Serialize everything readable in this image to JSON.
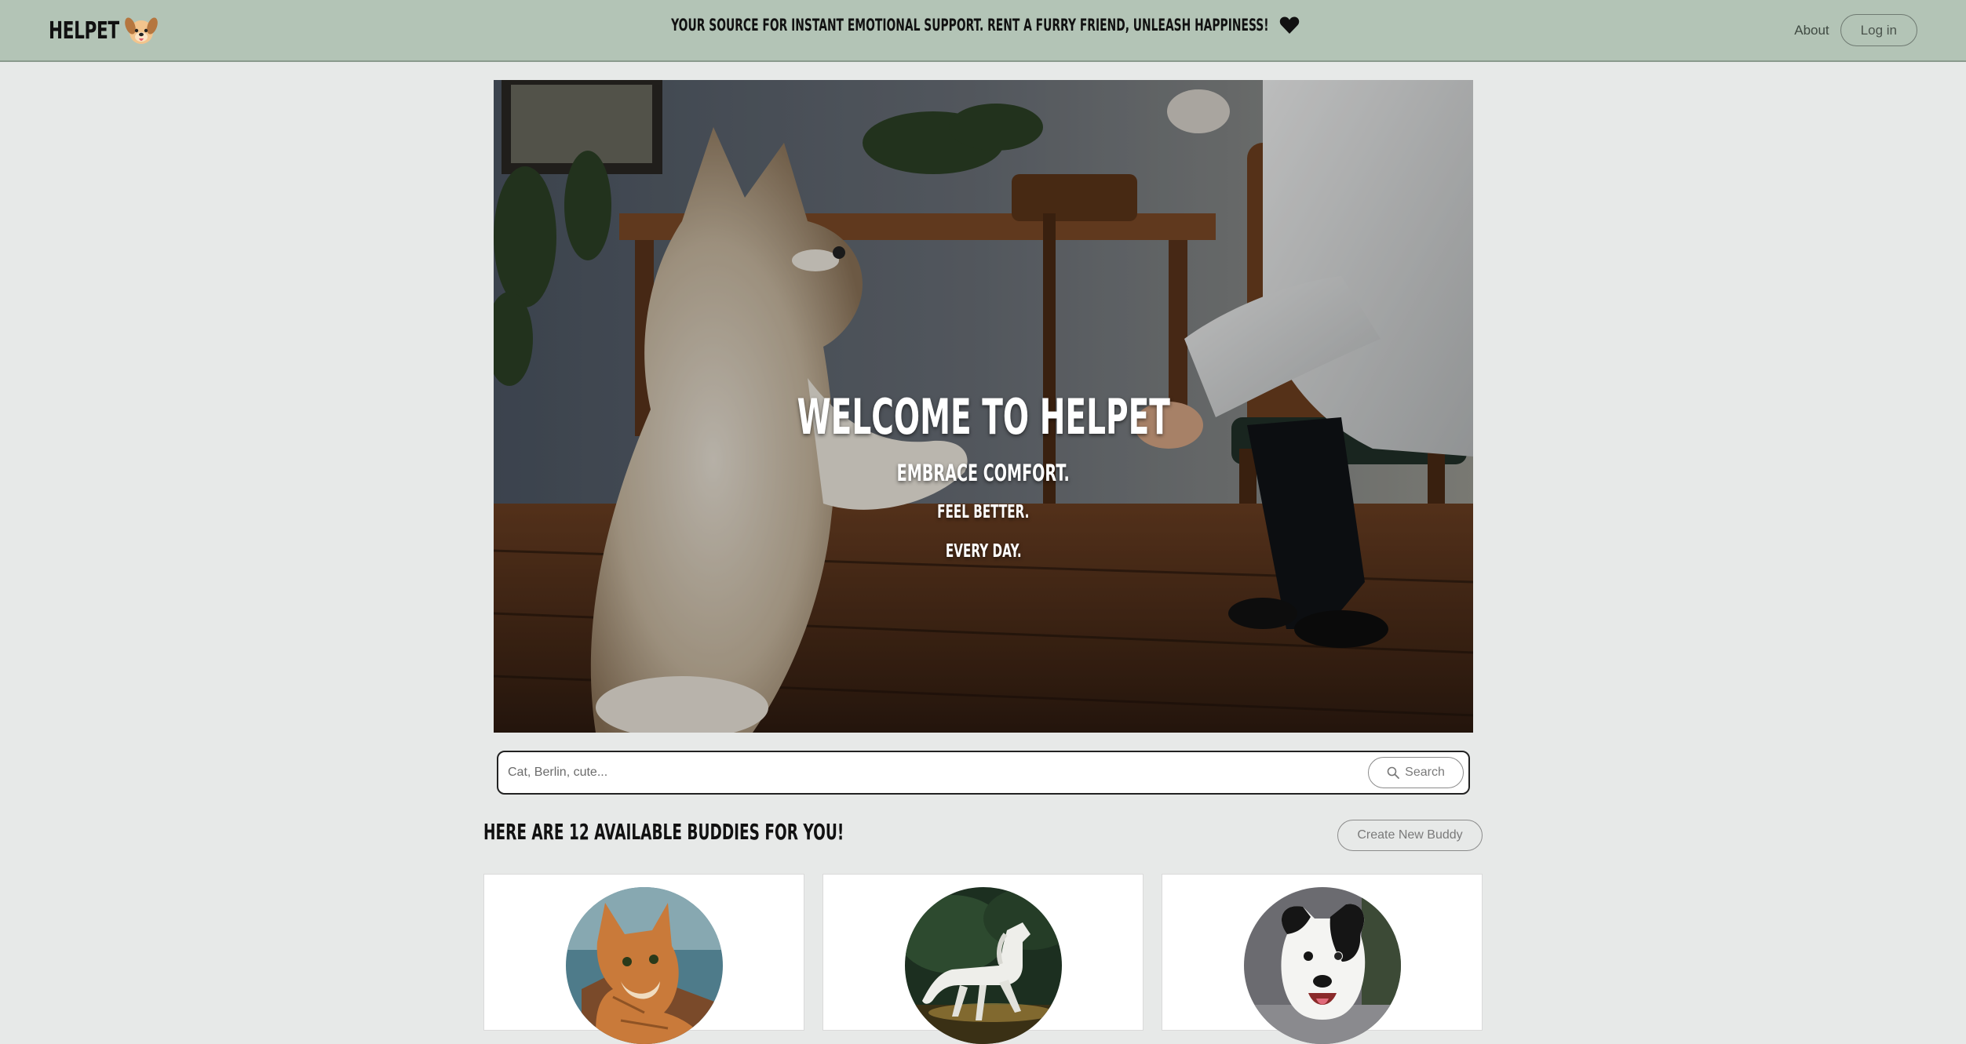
{
  "nav": {
    "brand": "HELPET",
    "tagline": "YOUR SOURCE FOR INSTANT EMOTIONAL SUPPORT. RENT A FURRY FRIEND, UNLEASH HAPPINESS!",
    "about_label": "About",
    "login_label": "Log in"
  },
  "hero": {
    "title": "WELCOME TO HELPET",
    "line1": "EMBRACE COMFORT.",
    "line2": "FEEL BETTER.",
    "line3": "EVERY DAY."
  },
  "search": {
    "placeholder": "Cat, Berlin, cute...",
    "button_label": "Search"
  },
  "buddies": {
    "heading": "HERE ARE 12 AVAILABLE BUDDIES FOR YOU!",
    "create_label": "Create New Buddy"
  },
  "colors": {
    "navbar": "#b3c4b6",
    "page_background": "#e7e9e8",
    "heart": "#111111"
  }
}
